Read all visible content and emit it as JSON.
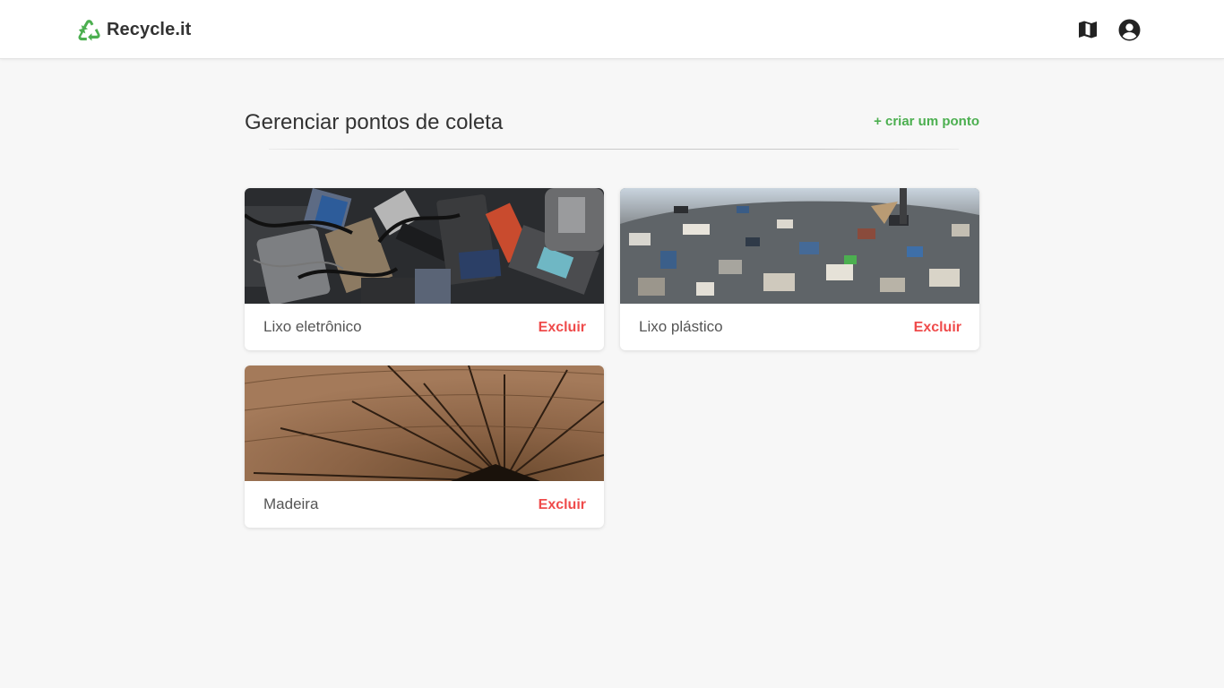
{
  "navbar": {
    "brand": "Recycle.it",
    "brand_icon": "recycle-icon",
    "brand_color": "#4caf50",
    "actions": [
      {
        "icon": "map-icon"
      },
      {
        "icon": "user-circle-icon"
      }
    ]
  },
  "header": {
    "title": "Gerenciar pontos de coleta",
    "create_link": "+ criar um ponto",
    "accent_color": "#4caf50"
  },
  "cards": [
    {
      "label": "Lixo eletrônico",
      "image": "electronic-waste-photo",
      "action": "Excluir"
    },
    {
      "label": "Lixo plástico",
      "image": "plastic-waste-photo",
      "action": "Excluir"
    },
    {
      "label": "Madeira",
      "image": "wood-photo",
      "action": "Excluir"
    }
  ],
  "colors": {
    "delete": "#ef4b4b",
    "background": "#f7f7f7"
  }
}
